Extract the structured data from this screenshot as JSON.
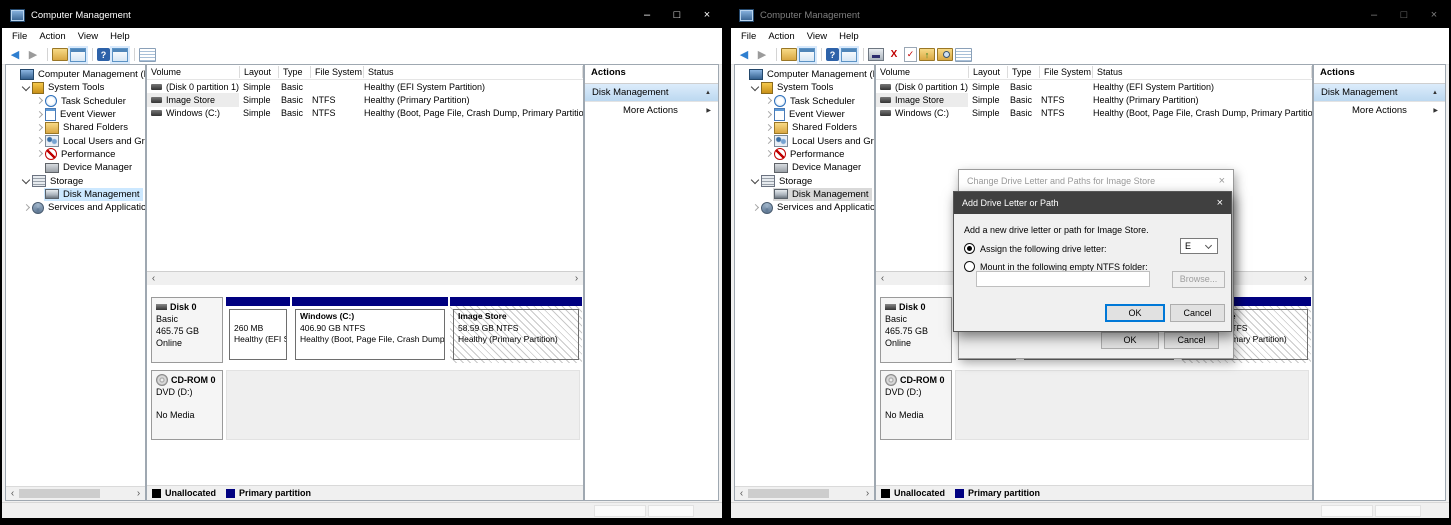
{
  "glyphs": {
    "minimize": "–",
    "maximize": "□",
    "close": "×",
    "scroll_left": "‹",
    "scroll_right": "›",
    "collapse_up": "▲",
    "expand_right": "▶"
  },
  "left_window": {
    "title": "Computer Management"
  },
  "right_window": {
    "title": "Computer Management"
  },
  "menu": [
    {
      "label": "File"
    },
    {
      "label": "Action"
    },
    {
      "label": "View"
    },
    {
      "label": "Help"
    }
  ],
  "toolbar_left": [
    {
      "name": "back-icon",
      "glyph": "◀",
      "cls": "tb-back"
    },
    {
      "name": "forward-icon",
      "glyph": "▶",
      "cls": "tb-fwd"
    },
    {
      "name": "separator",
      "cls": "tb-sep"
    },
    {
      "name": "export-list-icon",
      "cls": "tb-folder"
    },
    {
      "name": "show-console-tree-icon",
      "cls": "tb-win"
    },
    {
      "name": "separator",
      "cls": "tb-sep"
    },
    {
      "name": "help-icon",
      "glyph": "?",
      "cls": "tb-help"
    },
    {
      "name": "show-actions-pane-icon",
      "cls": "tb-win"
    },
    {
      "name": "separator",
      "cls": "tb-sep"
    },
    {
      "name": "properties-icon",
      "cls": "tb-props"
    }
  ],
  "toolbar_right": [
    {
      "name": "back-icon",
      "glyph": "◀",
      "cls": "tb-back"
    },
    {
      "name": "forward-icon",
      "glyph": "▶",
      "cls": "tb-fwd"
    },
    {
      "name": "separator",
      "cls": "tb-sep"
    },
    {
      "name": "export-list-icon",
      "cls": "tb-folder"
    },
    {
      "name": "show-console-tree-icon",
      "cls": "tb-win"
    },
    {
      "name": "separator",
      "cls": "tb-sep"
    },
    {
      "name": "help-icon",
      "glyph": "?",
      "cls": "tb-help"
    },
    {
      "name": "show-actions-pane-icon",
      "cls": "tb-win"
    },
    {
      "name": "separator",
      "cls": "tb-sep"
    },
    {
      "name": "console-icon",
      "cls": "tb-console"
    },
    {
      "name": "delete-icon",
      "glyph": "X",
      "cls": "tb-del"
    },
    {
      "name": "check-document-icon",
      "glyph": "✓",
      "cls": "tb-check"
    },
    {
      "name": "add-folder-icon",
      "glyph": "↑",
      "cls": "tb-upfolder"
    },
    {
      "name": "find-folder-icon",
      "cls": "tb-find"
    },
    {
      "name": "properties-icon",
      "cls": "tb-props"
    }
  ],
  "tree": [
    {
      "label": "Computer Management (Local",
      "chev": "noc",
      "icon": "ic-computer",
      "icon_name": "computer-icon",
      "pad": "padding-left:3px",
      "cls": ""
    },
    {
      "label": "System Tools",
      "chev": "exp",
      "icon": "ic-tools",
      "icon_name": "system-tools-icon",
      "pad": "padding-left:15px",
      "cls": ""
    },
    {
      "label": "Task Scheduler",
      "chev": "col",
      "icon": "ic-clock",
      "icon_name": "task-scheduler-icon",
      "pad": "padding-left:28px",
      "cls": ""
    },
    {
      "label": "Event Viewer",
      "chev": "col",
      "icon": "ic-event",
      "icon_name": "event-viewer-icon",
      "pad": "padding-left:28px",
      "cls": ""
    },
    {
      "label": "Shared Folders",
      "chev": "col",
      "icon": "ic-folders",
      "icon_name": "shared-folders-icon",
      "pad": "padding-left:28px",
      "cls": ""
    },
    {
      "label": "Local Users and Groups",
      "chev": "col",
      "icon": "ic-users",
      "icon_name": "local-users-and-groups-icon",
      "pad": "padding-left:28px",
      "cls": ""
    },
    {
      "label": "Performance",
      "chev": "col",
      "icon": "ic-perf",
      "icon_name": "performance-icon",
      "pad": "padding-left:28px",
      "cls": ""
    },
    {
      "label": "Device Manager",
      "chev": "noc",
      "icon": "ic-device",
      "icon_name": "device-manager-icon",
      "pad": "padding-left:28px",
      "cls": ""
    },
    {
      "label": "Storage",
      "chev": "exp",
      "icon": "ic-storage",
      "icon_name": "storage-icon",
      "pad": "padding-left:15px",
      "cls": ""
    },
    {
      "label": "Disk Management",
      "chev": "noc",
      "icon": "ic-disk",
      "icon_name": "disk-management-icon",
      "pad": "padding-left:28px",
      "cls": "sel"
    },
    {
      "label": "Services and Applications",
      "chev": "col",
      "icon": "ic-services",
      "icon_name": "services-and-applications-icon",
      "pad": "padding-left:15px",
      "cls": ""
    }
  ],
  "volume_table": {
    "columns": [
      {
        "label": "Volume",
        "cls": "c-vol"
      },
      {
        "label": "Layout",
        "cls": "c-lay"
      },
      {
        "label": "Type",
        "cls": "c-typ"
      },
      {
        "label": "File System",
        "cls": "c-fs"
      },
      {
        "label": "Status",
        "cls": "c-st"
      }
    ],
    "rows": [
      {
        "volume": "(Disk 0 partition 1)",
        "layout": "Simple",
        "type": "Basic",
        "fs": "",
        "status": "Healthy (EFI System Partition)",
        "vcls": ""
      },
      {
        "volume": "Image Store",
        "layout": "Simple",
        "type": "Basic",
        "fs": "NTFS",
        "status": "Healthy (Primary Partition)",
        "vcls": "sel"
      },
      {
        "volume": "Windows (C:)",
        "layout": "Simple",
        "type": "Basic",
        "fs": "NTFS",
        "status": "Healthy (Boot, Page File, Crash Dump, Primary Partition)",
        "vcls": ""
      }
    ]
  },
  "disk": {
    "name": "Disk 0",
    "kind": "Basic",
    "size": "465.75 GB",
    "state": "Online",
    "partitions": [
      {
        "name": "",
        "size": "260 MB",
        "status": "Healthy (EFI Sy",
        "style": "width:64px",
        "cls": ""
      },
      {
        "name": "Windows  (C:)",
        "size": "406.90 GB NTFS",
        "status": "Healthy (Boot, Page File, Crash Dump",
        "style": "width:156px",
        "cls": ""
      },
      {
        "name": "Image Store",
        "size": "58.59 GB NTFS",
        "status": "Healthy (Primary Partition)",
        "style": "width:132px",
        "cls": "hatch"
      }
    ]
  },
  "cdrom": {
    "name": "CD-ROM 0",
    "drive": "DVD (D:)",
    "media": "No Media"
  },
  "legend": [
    {
      "label": "Unallocated",
      "sq": "background:#000000"
    },
    {
      "label": "Primary partition",
      "sq": "background:#000080"
    }
  ],
  "actions": {
    "header": "Actions",
    "group_label": "Disk Management",
    "more_label": "More Actions"
  },
  "dialogs": {
    "back": {
      "title": "Change Drive Letter and Paths for Image Store",
      "ok": "OK",
      "cancel": "Cancel"
    },
    "front": {
      "title": "Add Drive Letter or Path",
      "message": "Add a new drive letter or path for Image Store.",
      "radio_assign": "Assign the following drive letter:",
      "drive_letter": "E",
      "radio_mount": "Mount in the following empty NTFS folder:",
      "mount_path": "",
      "browse": "Browse...",
      "ok": "OK",
      "cancel": "Cancel"
    }
  }
}
